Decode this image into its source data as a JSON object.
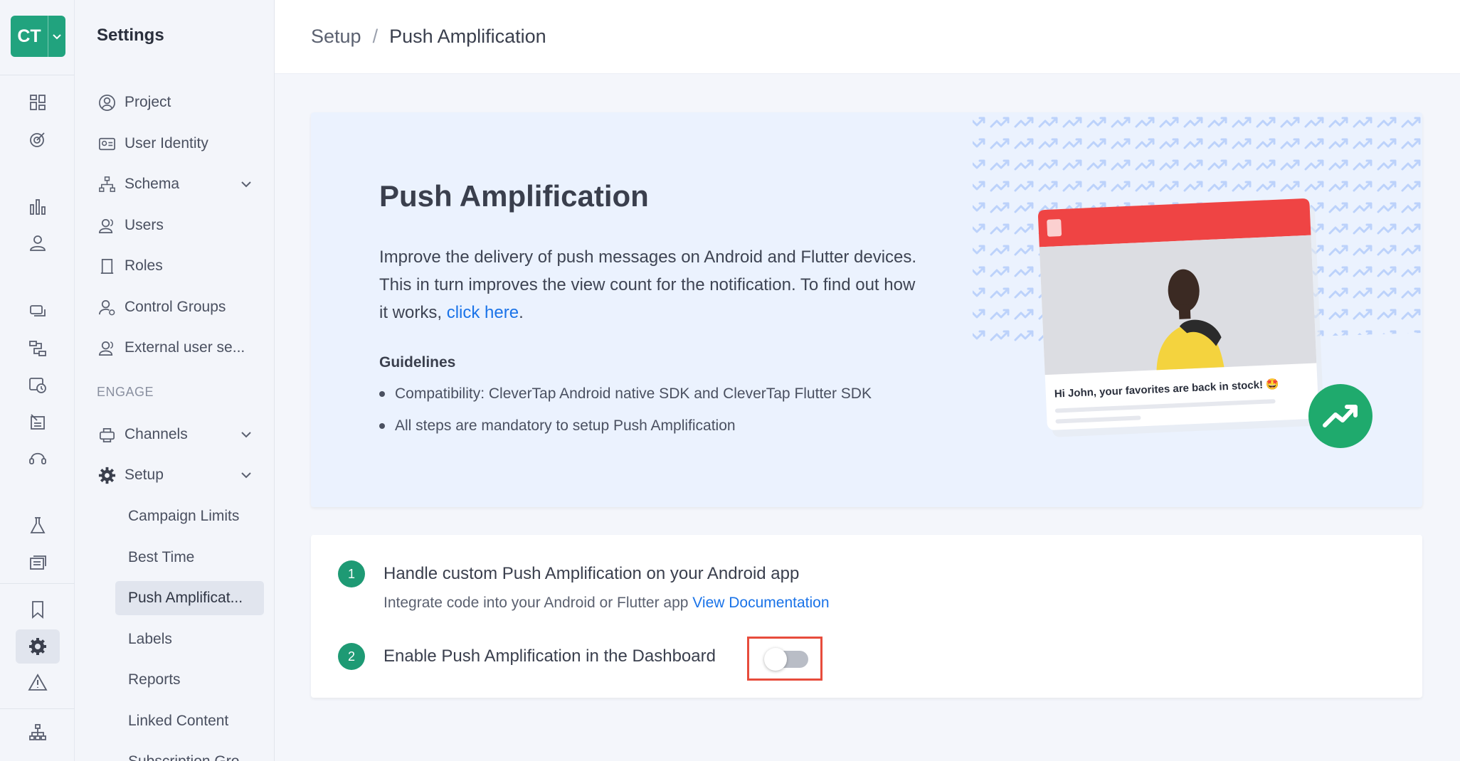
{
  "logo": {
    "text": "CT"
  },
  "sidebar": {
    "title": "Settings",
    "items": [
      {
        "label": "Project",
        "icon": "user-circle-icon"
      },
      {
        "label": "User Identity",
        "icon": "id-card-icon"
      },
      {
        "label": "Schema",
        "icon": "hierarchy-icon",
        "expandable": true
      },
      {
        "label": "Users",
        "icon": "users-icon"
      },
      {
        "label": "Roles",
        "icon": "scroll-icon"
      },
      {
        "label": "Control Groups",
        "icon": "user-gear-icon"
      },
      {
        "label": "External user se...",
        "icon": "users-external-icon"
      }
    ],
    "section_label": "ENGAGE",
    "engage_items": [
      {
        "label": "Channels",
        "icon": "channels-icon",
        "expandable": true
      },
      {
        "label": "Setup",
        "icon": "gear-icon",
        "expandable": true
      }
    ],
    "setup_items": [
      {
        "label": "Campaign Limits"
      },
      {
        "label": "Best Time"
      },
      {
        "label": "Push Amplificat...",
        "active": true
      },
      {
        "label": "Labels"
      },
      {
        "label": "Reports"
      },
      {
        "label": "Linked Content"
      },
      {
        "label": "Subscription Gro..."
      }
    ]
  },
  "header": {
    "breadcrumb_root": "Setup",
    "breadcrumb_separator": "/",
    "breadcrumb_current": "Push Amplification"
  },
  "hero": {
    "title": "Push Amplification",
    "description": "Improve the delivery of push messages on Android and Flutter devices. This in turn improves the view count for the notification. To find out how it works,",
    "link_text": "click here",
    "link_suffix": ".",
    "guidelines_title": "Guidelines",
    "guidelines": [
      "Compatibility: CleverTap Android native SDK and CleverTap Flutter SDK",
      "All steps are mandatory to setup Push Amplification"
    ],
    "notification_text": "Hi John,  your favorites are back in stock! 🤩"
  },
  "steps": [
    {
      "number": "1",
      "title": "Handle custom Push Amplification on your Android app",
      "description": "Integrate code into your Android or Flutter app",
      "link_text": "View Documentation"
    },
    {
      "number": "2",
      "title": "Enable Push Amplification in the Dashboard",
      "toggle_on": false
    }
  ],
  "colors": {
    "brand": "#21a37e",
    "step_badge": "#1e9a74",
    "link": "#1a73e8",
    "hero_bg": "#ebf2fe",
    "highlight_border": "#e74c3c",
    "notification_header": "#ef4444"
  }
}
